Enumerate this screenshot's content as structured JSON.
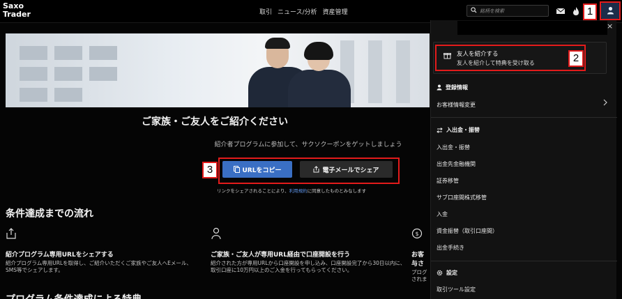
{
  "brand": {
    "line1": "Saxo",
    "line2": "Trader"
  },
  "nav": [
    "取引",
    "ニュース/分析",
    "資産管理"
  ],
  "search": {
    "placeholder": "銘柄を検索"
  },
  "icons": {
    "mail": "mail-icon",
    "flame": "flame-icon",
    "user": "user-icon"
  },
  "markers": [
    "1",
    "2",
    "3"
  ],
  "hero": {
    "headline": "ご家族・ご友人をご紹介ください",
    "subline": "紹介者プログラムに参加して、サクソクーポンをゲットしましょう",
    "copy_button": "URLをコピー",
    "email_button": "電子メールでシェア",
    "notice_pre": "リンクをシェアされることにより、",
    "notice_link": "利用規約",
    "notice_post": "に同意したものとみなします"
  },
  "flow": {
    "title": "条件達成までの流れ",
    "steps": [
      {
        "icon": "share-icon",
        "title": "紹介プログラム専用URLをシェアする",
        "desc": "紹介プログラム専用URLを取得し、ご紹介いただくご家族やご友人へEメール、SMS等でシェアします。"
      },
      {
        "icon": "person-icon",
        "title": "ご家族・ご友人が専用URL経由で口座開設を行う",
        "desc": "紹介された方が専用URLから口座開設を申し込み、口座開設完了から30日以内に、取引口座に10万円以上のご入金を行ってもらってください。"
      },
      {
        "icon": "dollar-icon",
        "title": "お客",
        "title2": "与さ",
        "desc": "プログ されま"
      }
    ],
    "next_title": "プログラム条件達成による特典"
  },
  "panel": {
    "close": "×",
    "refer_title": "友人を紹介する",
    "refer_sub": "友人を紹介して特典を受け取る",
    "sections": [
      {
        "heading": "登録情報",
        "items": [
          "お客様情報変更"
        ]
      },
      {
        "heading": "入出金・振替",
        "items": [
          "入出金・振替",
          "出金先金融機関",
          "証券移管",
          "サブ口座間株式移管",
          "入金",
          "資金振替（取引口座間）",
          "出金手続き"
        ]
      },
      {
        "heading": "設定",
        "items": [
          "取引ツール設定"
        ]
      }
    ]
  },
  "colors": {
    "accent": "#3a6fc4",
    "marker": "#e31b1b",
    "background": "#050505",
    "panel": "#121212"
  }
}
